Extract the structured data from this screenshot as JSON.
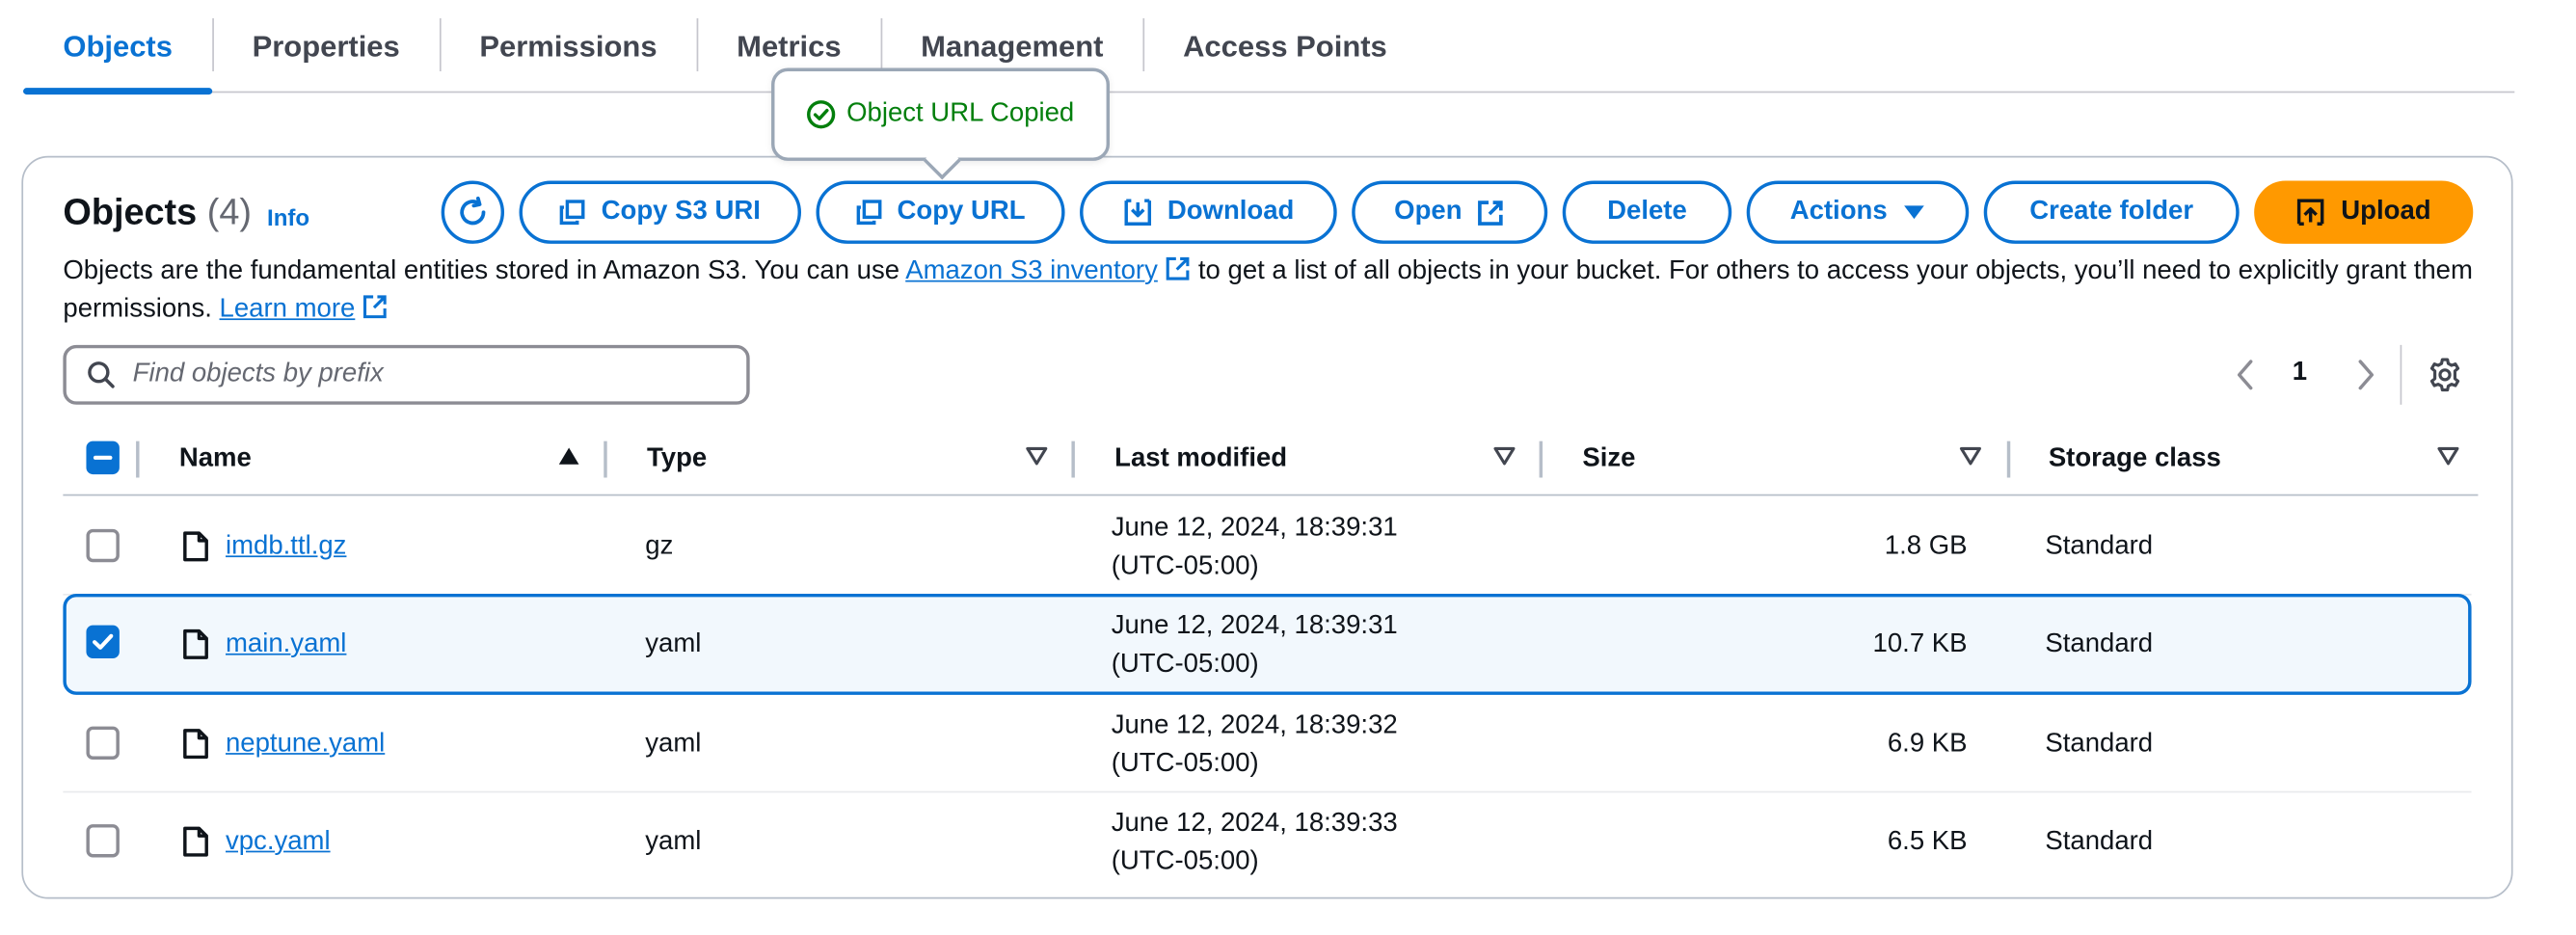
{
  "tabs": [
    {
      "label": "Objects",
      "active": true
    },
    {
      "label": "Properties"
    },
    {
      "label": "Permissions"
    },
    {
      "label": "Metrics"
    },
    {
      "label": "Management"
    },
    {
      "label": "Access Points"
    }
  ],
  "popover": {
    "message": "Object URL Copied",
    "color": "#037f0c"
  },
  "header": {
    "title": "Objects",
    "count": "(4)",
    "info": "Info"
  },
  "toolbar": {
    "copy_s3_uri": "Copy S3 URI",
    "copy_url": "Copy URL",
    "download": "Download",
    "open": "Open",
    "delete": "Delete",
    "actions": "Actions",
    "create_folder": "Create folder",
    "upload": "Upload"
  },
  "description": {
    "part1": "Objects are the fundamental entities stored in Amazon S3. You can use ",
    "inventory_link": "Amazon S3 inventory",
    "part2": " to get a list of all objects in your bucket. For others to access your objects, you’ll need to explicitly grant them permissions. ",
    "learn_more": "Learn more"
  },
  "search": {
    "placeholder": "Find objects by prefix",
    "value": ""
  },
  "pagination": {
    "page": "1"
  },
  "table": {
    "columns": [
      "Name",
      "Type",
      "Last modified",
      "Size",
      "Storage class"
    ],
    "rows": [
      {
        "name": "imdb.ttl.gz",
        "type": "gz",
        "modified_date": "June 12, 2024, 18:39:31",
        "modified_tz": "(UTC-05:00)",
        "size": "1.8 GB",
        "storage": "Standard",
        "checked": false
      },
      {
        "name": "main.yaml",
        "type": "yaml",
        "modified_date": "June 12, 2024, 18:39:31",
        "modified_tz": "(UTC-05:00)",
        "size": "10.7 KB",
        "storage": "Standard",
        "checked": true
      },
      {
        "name": "neptune.yaml",
        "type": "yaml",
        "modified_date": "June 12, 2024, 18:39:32",
        "modified_tz": "(UTC-05:00)",
        "size": "6.9 KB",
        "storage": "Standard",
        "checked": false
      },
      {
        "name": "vpc.yaml",
        "type": "yaml",
        "modified_date": "June 12, 2024, 18:39:33",
        "modified_tz": "(UTC-05:00)",
        "size": "6.5 KB",
        "storage": "Standard",
        "checked": false
      }
    ]
  },
  "colors": {
    "accent": "#0972d3",
    "primary_button": "#ff9900",
    "success": "#037f0c"
  }
}
